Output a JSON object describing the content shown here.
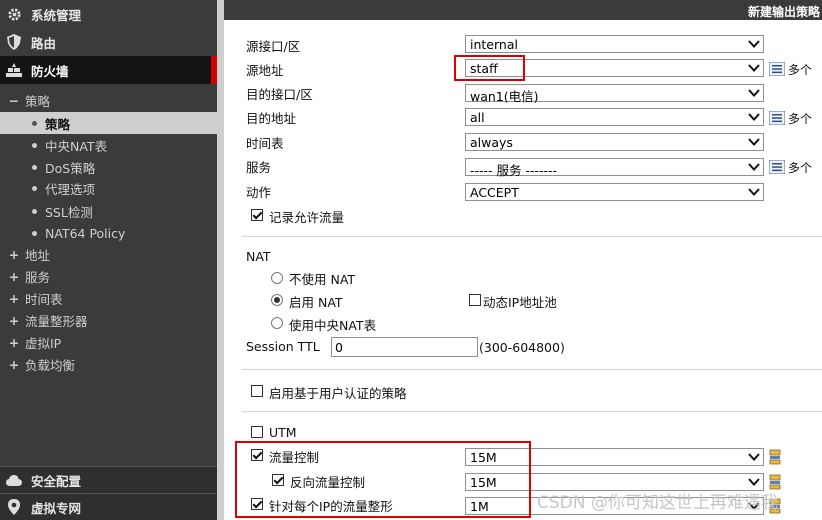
{
  "sidebar": {
    "system": "系统管理",
    "route": "路由",
    "firewall": "防火墙",
    "policy_group": "策略",
    "policy_items": [
      "策略",
      "中央NAT表",
      "DoS策略",
      "代理选项",
      "SSL检测",
      "NAT64 Policy"
    ],
    "tree_items": [
      "地址",
      "服务",
      "时间表",
      "流量整形器",
      "虚拟IP",
      "负载均衡"
    ],
    "security_profile": "安全配置",
    "vpn": "虚拟专网"
  },
  "header": {
    "title": "新建输出策略"
  },
  "form": {
    "src_intf": {
      "label": "源接口/区",
      "value": "internal"
    },
    "src_addr": {
      "label": "源地址",
      "value": "staff"
    },
    "dst_intf": {
      "label": "目的接口/区",
      "value": "wan1(电信)"
    },
    "dst_addr": {
      "label": "目的地址",
      "value": "all"
    },
    "schedule": {
      "label": "时间表",
      "value": "always"
    },
    "service": {
      "label": "服务",
      "value": "----- 服务 -------"
    },
    "action": {
      "label": "动作",
      "value": "ACCEPT"
    },
    "more_label": "多个",
    "log_allowed": "记录允许流量",
    "nat_title": "NAT",
    "nat_options": [
      "不使用 NAT",
      "启用 NAT",
      "使用中央NAT表"
    ],
    "dynamic_ip_pool": "动态IP地址池",
    "session_ttl": {
      "label": "Session TTL",
      "value": "0",
      "hint": "(300-604800)"
    },
    "auth_policy": "启用基于用户认证的策略",
    "utm": "UTM",
    "traffic_shaping": {
      "label": "流量控制",
      "value": "15M"
    },
    "reverse_shaping": {
      "label": "反向流量控制",
      "value": "15M"
    },
    "per_ip_shaping": {
      "label": "针对每个IP的流量整形",
      "value": "1M"
    }
  },
  "watermark": "CSDN @你可知这世上再难遇我"
}
